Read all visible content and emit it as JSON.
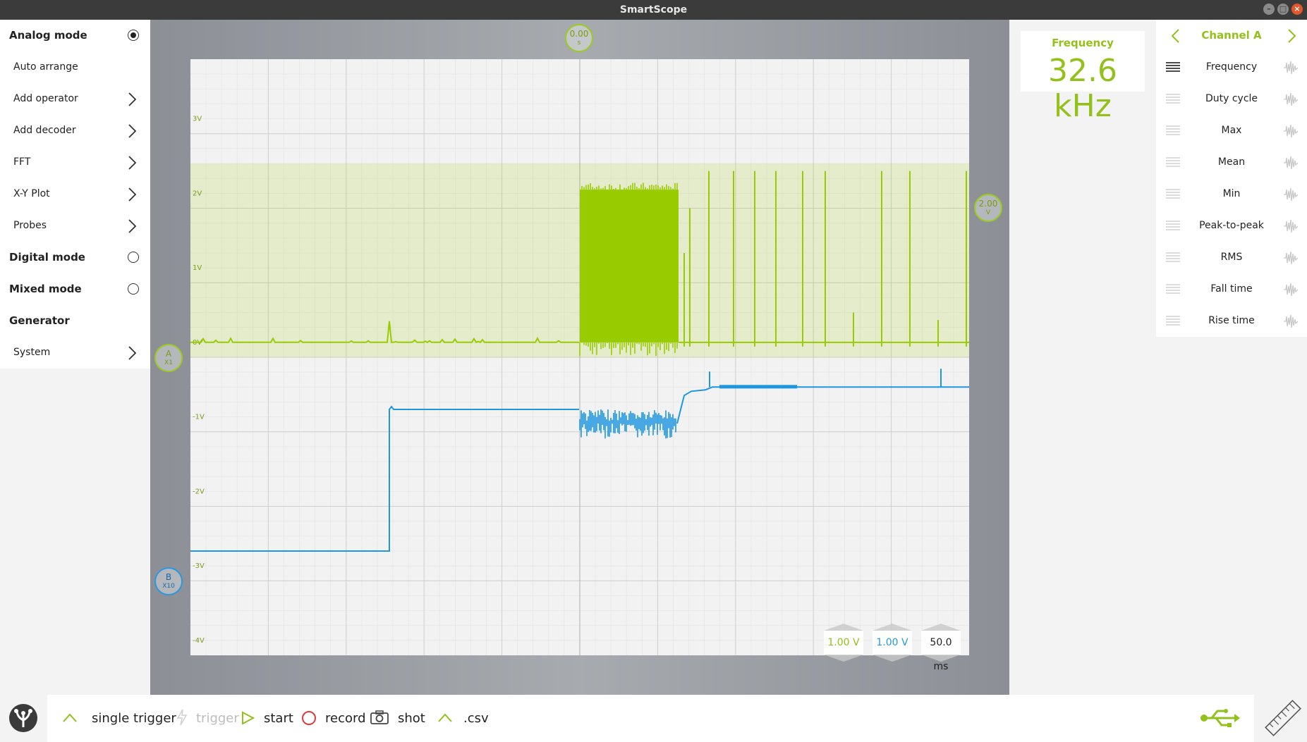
{
  "window": {
    "title": "SmartScope"
  },
  "left_menu": {
    "items": [
      {
        "label": "Analog mode",
        "kind": "radio",
        "selected": true,
        "bold": true
      },
      {
        "label": "Auto arrange",
        "kind": "plain"
      },
      {
        "label": "Add operator",
        "kind": "submenu"
      },
      {
        "label": "Add decoder",
        "kind": "submenu"
      },
      {
        "label": "FFT",
        "kind": "submenu"
      },
      {
        "label": "X-Y Plot",
        "kind": "submenu"
      },
      {
        "label": "Probes",
        "kind": "submenu"
      },
      {
        "label": "Digital mode",
        "kind": "radio",
        "selected": false,
        "bold": true
      },
      {
        "label": "Mixed mode",
        "kind": "radio",
        "selected": false,
        "bold": true
      },
      {
        "label": "Generator",
        "kind": "plain",
        "bold": true
      },
      {
        "label": "System",
        "kind": "submenu"
      }
    ]
  },
  "scope": {
    "time_marker": {
      "value": "0.00",
      "unit": "s"
    },
    "trigger_marker": {
      "value": "2.00",
      "unit": "V"
    },
    "channel_a_marker": {
      "name": "A",
      "probe": "X1"
    },
    "channel_b_marker": {
      "name": "B",
      "probe": "X10"
    },
    "y_labels": [
      "3V",
      "2V",
      "1V",
      "0V",
      "-1V",
      "-2V",
      "-3V",
      "-4V"
    ],
    "scales": {
      "channel_a": "1.00 V",
      "channel_b": "1.00 V",
      "time": "50.0 ms"
    },
    "colors": {
      "channel_a": "#99cc00",
      "channel_b": "#1e96e0",
      "grid": "#d6d6d6",
      "background": "#f2f2f2"
    }
  },
  "measurement_display": {
    "title": "Frequency",
    "value": "32.6 kHz"
  },
  "right_menu": {
    "channel": "Channel A",
    "items": [
      {
        "label": "Frequency",
        "active": true
      },
      {
        "label": "Duty cycle",
        "active": false
      },
      {
        "label": "Max",
        "active": false
      },
      {
        "label": "Mean",
        "active": false
      },
      {
        "label": "Min",
        "active": false
      },
      {
        "label": "Peak-to-peak",
        "active": false
      },
      {
        "label": "RMS",
        "active": false
      },
      {
        "label": "Fall time",
        "active": false
      },
      {
        "label": "Rise time",
        "active": false
      }
    ]
  },
  "toolbar": {
    "single_trigger": "single trigger",
    "trigger": "trigger",
    "start": "start",
    "record": "record",
    "shot": "shot",
    "csv": ".csv"
  },
  "icons": {
    "logo": "smartscope-logo-icon",
    "usb": "usb-icon",
    "ruler": "ruler-icon"
  }
}
